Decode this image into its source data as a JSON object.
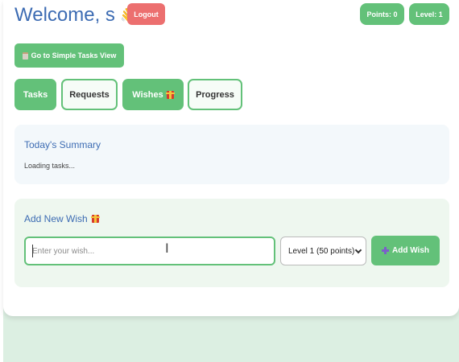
{
  "header": {
    "welcome_text": "Welcome, s",
    "wave_emoji": "👋",
    "logout_label": "Logout",
    "points_label": "Points: 0",
    "level_label": "Level: 1"
  },
  "simple_view_button": {
    "label": "Go to Simple Tasks View",
    "icon": "clipboard-icon"
  },
  "tabs": [
    {
      "label": "Tasks",
      "active": false
    },
    {
      "label": "Requests",
      "active": false
    },
    {
      "label": "Wishes",
      "active": true,
      "icon": "gift-icon"
    },
    {
      "label": "Progress",
      "active": false
    }
  ],
  "summary": {
    "title": "Today's Summary",
    "status": "Loading tasks..."
  },
  "wish_form": {
    "title": "Add New Wish",
    "title_icon": "gift-icon",
    "input_placeholder": "Enter your wish...",
    "input_value": "",
    "level_selected": "Level 1 (50 points)",
    "add_label": "Add Wish",
    "add_icon": "plus-icon"
  },
  "colors": {
    "accent_green": "#63c179",
    "logout_red": "#ec6f6f",
    "title_blue": "#3d6cb3",
    "page_bg": "#dcefe2"
  }
}
